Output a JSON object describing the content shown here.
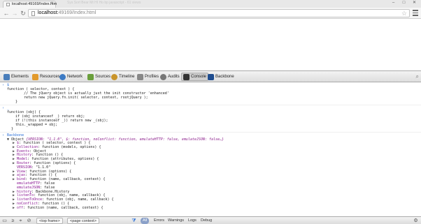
{
  "browser": {
    "tab_title": "localhost:49169/Index.htm",
    "tab_close": "×",
    "ghost_tab_title": "Sys Sort Bear Mt HI Ho bp javascript - 61 views",
    "window_controls": [
      "–",
      "□",
      "✕"
    ],
    "back_icon": "←",
    "forward_icon": "→",
    "reload_icon": "↻",
    "url_host": "localhost:",
    "url_port_path": "49169/Index.html",
    "star_icon": "☆"
  },
  "devtools": {
    "tabs": [
      {
        "label": "Elements",
        "color": "#4a7ebb"
      },
      {
        "label": "Resources",
        "color": "#e29a2c"
      },
      {
        "label": "Network",
        "color": "#3c7ac4"
      },
      {
        "label": "Sources",
        "color": "#6a9f3c"
      },
      {
        "label": "Timeline",
        "color": "#c9942a"
      },
      {
        "label": "Profiles",
        "color": "#888888"
      },
      {
        "label": "Audits",
        "color": "#777777"
      },
      {
        "label": "Console",
        "color": "#333333"
      },
      {
        "label": "Backbone",
        "color": "#1f4d8f"
      }
    ],
    "search_icon": "⌕",
    "console": {
      "entry1": {
        "input": "$",
        "lines": [
          "function ( selector, context ) {",
          "        // The jQuery object is actually just the init constructor 'enhanced'",
          "        return new jQuery.fn.init( selector, context, rootjQuery );",
          "    }"
        ]
      },
      "entry2": {
        "input": "_",
        "lines": [
          "function (obj) {",
          "    if (obj instanceof _) return obj;",
          "    if (!(this instanceof _)) return new _(obj);",
          "    this._wrapped = obj;",
          "  }"
        ]
      },
      "entry3": {
        "input": "Backbone",
        "head_prefix": "▼ Object ",
        "head_summary": "{VERSION: \"1.1.0\", $: function, noConflict: function, emulateHTTP: false, emulateJSON: false…}",
        "props": [
          [
            "▶ ",
            "$",
            ": function ( selector, context ) {"
          ],
          [
            "▶ ",
            "Collection",
            ": function (models, options) {"
          ],
          [
            "▶ ",
            "Events",
            ": Object"
          ],
          [
            "▶ ",
            "History",
            ": function () {"
          ],
          [
            "▶ ",
            "Model",
            ": function (attributes, options) {"
          ],
          [
            "▶ ",
            "Router",
            ": function (options) {"
          ],
          [
            "  ",
            "VERSION",
            ": \"1.1.0\""
          ],
          [
            "▶ ",
            "View",
            ": function (options) {"
          ],
          [
            "▶ ",
            "ajax",
            ": function () {"
          ],
          [
            "▶ ",
            "bind",
            ": function (name, callback, context) {"
          ],
          [
            "  ",
            "emulateHTTP",
            ": false"
          ],
          [
            "  ",
            "emulateJSON",
            ": false"
          ],
          [
            "▶ ",
            "history",
            ": Backbone.History"
          ],
          [
            "▶ ",
            "listenTo",
            ": function (obj, name, callback) {"
          ],
          [
            "▶ ",
            "listenToOnce",
            ": function (obj, name, callback) {"
          ],
          [
            "▶ ",
            "noConflict",
            ": function () {"
          ],
          [
            "▶ ",
            "off",
            ": function (name, callback, context) {"
          ]
        ]
      }
    },
    "status": {
      "frame_select": "<top frame>",
      "context_select": "<page context>",
      "filter_all": "All",
      "filters": [
        "Errors",
        "Warnings",
        "Logs",
        "Debug"
      ],
      "gear_icon": "⚙"
    }
  }
}
